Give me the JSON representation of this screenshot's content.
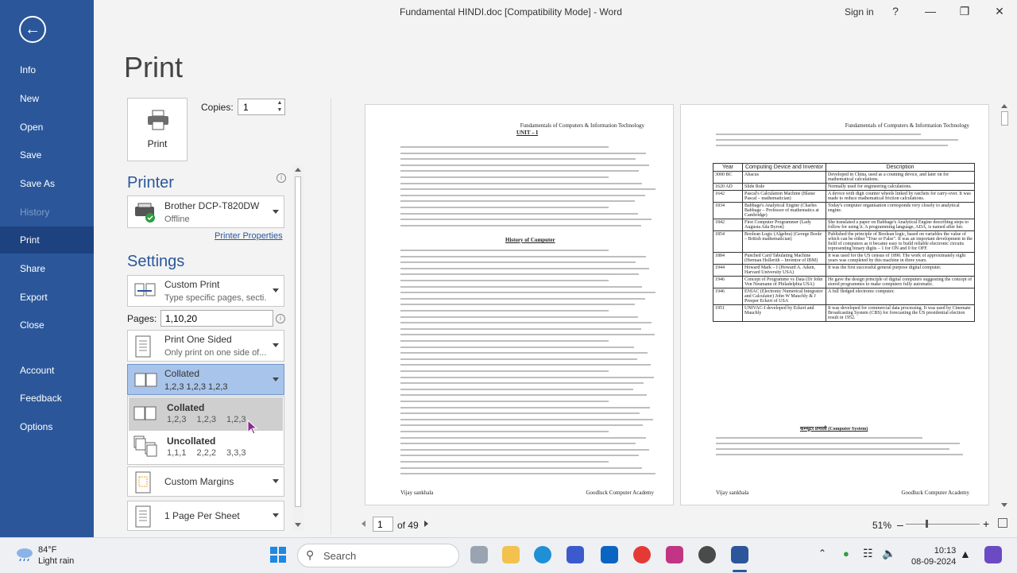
{
  "window": {
    "title": "Fundamental HINDI.doc [Compatibility Mode]  -  Word",
    "sign_in": "Sign in",
    "help": "?"
  },
  "nav": {
    "items": [
      {
        "label": "Info"
      },
      {
        "label": "New"
      },
      {
        "label": "Open"
      },
      {
        "label": "Save"
      },
      {
        "label": "Save As"
      },
      {
        "label": "History"
      },
      {
        "label": "Print"
      },
      {
        "label": "Share"
      },
      {
        "label": "Export"
      },
      {
        "label": "Close"
      },
      {
        "label": "Account"
      },
      {
        "label": "Feedback"
      },
      {
        "label": "Options"
      }
    ]
  },
  "print": {
    "heading": "Print",
    "button_label": "Print",
    "copies_label": "Copies:",
    "copies_value": "1",
    "printer_heading": "Printer",
    "printer_name": "Brother DCP-T820DW",
    "printer_status": "Offline",
    "printer_properties": "Printer Properties",
    "settings_heading": "Settings",
    "range_title": "Custom Print",
    "range_sub": "Type specific pages, secti...",
    "pages_label": "Pages:",
    "pages_value": "1,10,20",
    "sides_title": "Print One Sided",
    "sides_sub": "Only print on one side of...",
    "collate_title": "Collated",
    "collate_sub": "1,2,3    1,2,3    1,2,3",
    "options": [
      {
        "title": "Collated",
        "sub": "1,2,3 1,2,3 1,2,3"
      },
      {
        "title": "Uncollated",
        "sub": "1,1,1 2,2,2 3,3,3"
      }
    ],
    "margins": "Custom Margins",
    "per_sheet": "1 Page Per Sheet"
  },
  "preview": {
    "page1": {
      "header": "Fundamentals of Computers & Information Technology",
      "unit": "UNIT – I",
      "history_heading": "History of Computer",
      "footer_left": "Vijay sankhala",
      "footer_right": "Goodluck Computer Academy"
    },
    "page2": {
      "header": "Fundamentals of Computers & Information Technology",
      "table_headers": [
        "Year",
        "Computing Device and Inventor",
        "Description"
      ],
      "table_rows": [
        [
          "3000 BC",
          "Abacus",
          "Developed in China, used as a counting device, and later on for mathematical calculations."
        ],
        [
          "1620 AD",
          "Slide Rule",
          "Normally used for engineering calculations."
        ],
        [
          "1642",
          "Pascal's Calculation Machine (Blaise Pascal – mathematician)",
          "A device with digit counter wheels linked by ratchets for carry-over. It was made to reduce mathematical friction calculations."
        ],
        [
          "1834",
          "Babbage's Analytical Engine (Charles Babbage – Professor of mathematics at Cambridge)",
          "Today's computer organisation corresponds very closely to analytical engine."
        ],
        [
          "1842",
          "First Computer Programmer (Lady Augusta Ada Byron)",
          "She translated a paper on Babbage's Analytical Engine describing steps to follow for using it. A programming language, ADA, is named after her."
        ],
        [
          "1854",
          "Boolean Logic (Algebra) (George Boole – British mathematician)",
          "Published the principle of Boolean logic, based on variables the value of which can be either \"True or False\". It was an important development in the field of computers as it became easy to build reliable electronic circuits representing binary digits – 1 for ON and 0 for OFF."
        ],
        [
          "1884",
          "Punched Card Tabulating Machine (Herman Hollerith – Inventor of IBM)",
          "It was used for the US census of 1890. The work of approximately eight years was completed by this machine in three years."
        ],
        [
          "1944",
          "Howard Mark – I (Howard A. Aiken, Harvard University USA)",
          "It was the first successful general purpose digital computer."
        ],
        [
          "1946",
          "Concept of Programme vs Data (Dr John Von Neumann of Philadelphia USA)",
          "He gave the design principle of digital computers suggesting the concept of stored programmes to make computers fully automatic."
        ],
        [
          "1946",
          "ENIAC (Electronic Numerical Integrator and Calculator) John W Mauchly & J Presper Eckert of USA",
          "A full fledged electronic computer."
        ],
        [
          "1951",
          "UNIVAC-I developed by Eckert and Mauchly",
          "It was developed for commercial data processing. It was used by Cinemate Broadcasting System (CBS) for forecasting the US presidential election result in 1952."
        ]
      ],
      "section_heading": "कम्प्यूटर प्रणाली (Computer System)",
      "footer_left": "Vijay sankhala",
      "footer_right": "Goodluck Computer Academy"
    },
    "page_current": "1",
    "page_total": "of 49",
    "zoom": "51%"
  },
  "taskbar": {
    "temp": "84°F",
    "weather": "Light rain",
    "search": "Search",
    "time": "10:13",
    "date": "08-09-2024"
  }
}
